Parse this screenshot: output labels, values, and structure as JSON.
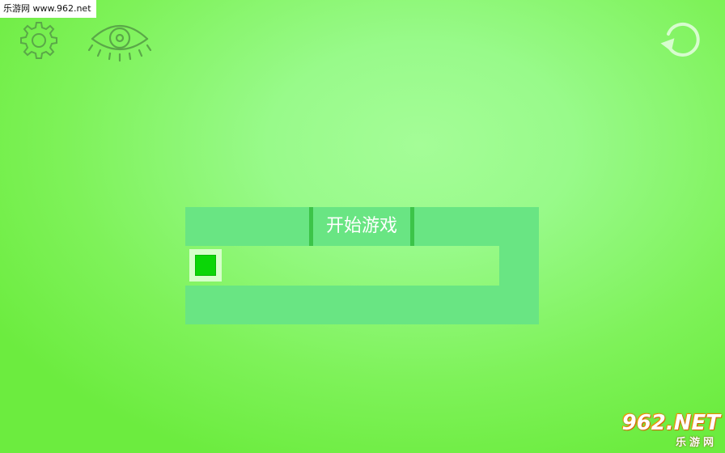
{
  "watermark": {
    "top_text": "乐游网 www.962.net",
    "logo_main": "962.NET",
    "logo_sub": "乐游网"
  },
  "toolbar": {
    "settings_icon": "gear-icon",
    "view_icon": "eye-icon",
    "restart_icon": "restart-icon"
  },
  "menu": {
    "start_label": "开始游戏"
  },
  "colors": {
    "background_light": "#a4fd97",
    "background_dark": "#6cec3f",
    "maze_path": "#69e583",
    "button_edge": "#3cc449",
    "player": "#0bd607",
    "player_frame": "#d6ffca",
    "icon_stroke": "#5aa848",
    "restart_icon": "#d7fcce"
  }
}
